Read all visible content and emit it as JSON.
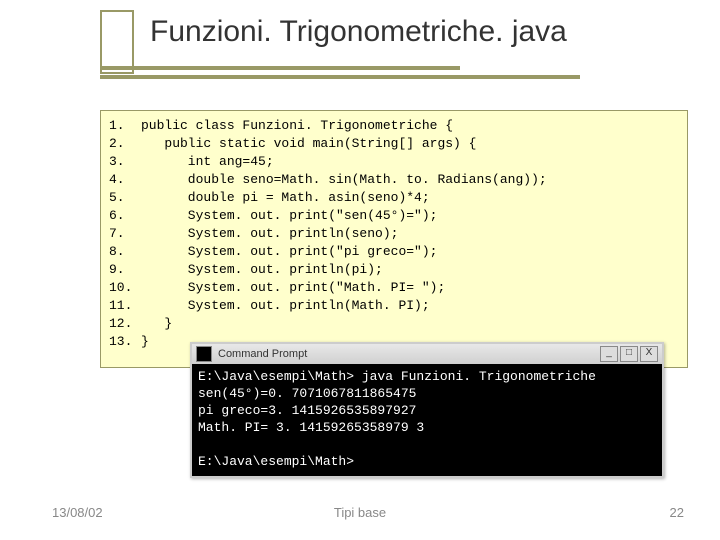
{
  "title": "Funzioni. Trigonometriche. java",
  "code": [
    {
      "n": "1.",
      "t": "public class Funzioni. Trigonometriche {"
    },
    {
      "n": "2.",
      "t": "   public static void main(String[] args) {"
    },
    {
      "n": "3.",
      "t": "      int ang=45;"
    },
    {
      "n": "4.",
      "t": "      double seno=Math. sin(Math. to. Radians(ang));"
    },
    {
      "n": "5.",
      "t": "      double pi = Math. asin(seno)*4;"
    },
    {
      "n": "6.",
      "t": "      System. out. print(\"sen(45°)=\");"
    },
    {
      "n": "7.",
      "t": "      System. out. println(seno);"
    },
    {
      "n": "8.",
      "t": "      System. out. print(\"pi greco=\");"
    },
    {
      "n": "9.",
      "t": "      System. out. println(pi);"
    },
    {
      "n": "10.",
      "t": "      System. out. print(\"Math. PI= \");"
    },
    {
      "n": "11.",
      "t": "      System. out. println(Math. PI);"
    },
    {
      "n": "12.",
      "t": "   }"
    },
    {
      "n": "13.",
      "t": "}"
    }
  ],
  "terminal": {
    "title": "Command Prompt",
    "lines": [
      "E:\\Java\\esempi\\Math> java Funzioni. Trigonometriche",
      "sen(45°)=0. 7071067811865475",
      "pi greco=3. 1415926535897927",
      "Math. PI= 3. 14159265358979 3",
      "",
      "E:\\Java\\esempi\\Math>"
    ],
    "buttons": {
      "min": "_",
      "max": "□",
      "close": "X"
    }
  },
  "footer": {
    "date": "13/08/02",
    "center": "Tipi base",
    "page": "22"
  }
}
